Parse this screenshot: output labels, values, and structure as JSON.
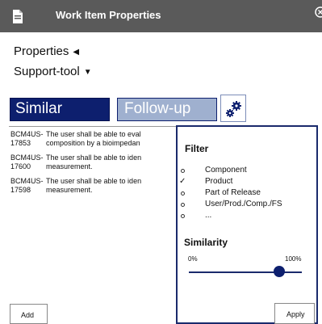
{
  "window": {
    "title": "Work Item Properties",
    "doc_icon": "document-icon",
    "close_icon": "close-icon"
  },
  "properties": {
    "label": "Properties",
    "caret": "◀"
  },
  "support_tool": {
    "label": "Support-tool",
    "caret": "▼"
  },
  "tabs": [
    {
      "label": "Similar",
      "selected": true
    },
    {
      "label": "Follow-up",
      "selected": false
    }
  ],
  "settings_button": {
    "icon": "gears-icon"
  },
  "results": [
    {
      "id": "BCM4US-17853",
      "text_line1": "The user shall be able to eval",
      "text_line2": "composition by a bioimpedan"
    },
    {
      "id": "BCM4US-17600",
      "text_line1": "The user shall be able to iden",
      "text_line2": "measurement."
    },
    {
      "id": "BCM4US-17598",
      "text_line1": "The user shall be able to iden",
      "text_line2": "measurement."
    }
  ],
  "add_button": {
    "label": "Add"
  },
  "filter": {
    "title": "Filter",
    "items": [
      {
        "label": "Component",
        "checked": false,
        "mark": ""
      },
      {
        "label": "Product",
        "checked": true,
        "mark": "✓"
      },
      {
        "label": "Part of Release",
        "checked": false,
        "mark": ""
      },
      {
        "label": "User/Prod./Comp./FS",
        "checked": false,
        "mark": ""
      },
      {
        "label": "...",
        "checked": false,
        "mark": ""
      }
    ],
    "similarity": {
      "title": "Similarity",
      "min_label": "0%",
      "max_label": "100%",
      "value_fraction": 0.8
    },
    "apply_label": "Apply"
  },
  "colors": {
    "titlebar": "#5a5a5a",
    "tab_selected": "#0d1f6e",
    "tab_unselected": "#9fb0cf",
    "popup_border": "#1a2a6c"
  }
}
